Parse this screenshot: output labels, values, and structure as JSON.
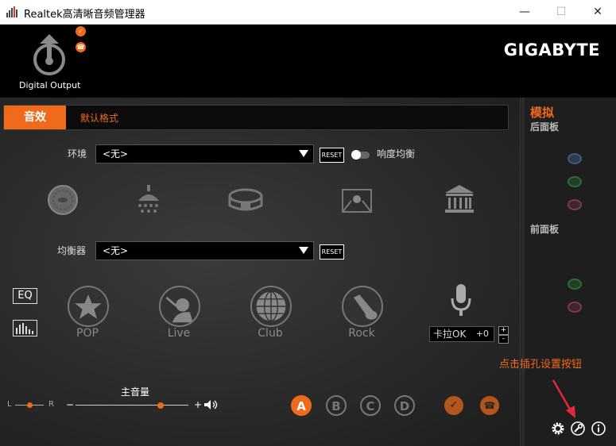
{
  "window": {
    "title": "Realtek高清晰音频管理器",
    "minimize_glyph": "—",
    "maximize_glyph": "☐",
    "close_glyph": "✕"
  },
  "header": {
    "device_label": "Digital Output",
    "brand": "GIGABYTE",
    "device_icon": "digital-output-icon"
  },
  "tabs": {
    "active": "音效",
    "default_format": "默认格式"
  },
  "environment": {
    "label": "环境",
    "value": "<无>",
    "reset": "RESET",
    "loudness_label": "响度均衡",
    "loudness_on": false,
    "icons": [
      "sewer-icon",
      "shower-icon",
      "stadium-icon",
      "room-icon",
      "concert-hall-icon"
    ]
  },
  "equalizer": {
    "label": "均衡器",
    "value": "<无>",
    "reset": "RESET",
    "eq_button": "EQ",
    "graphic_icon": "graphic-eq-icon",
    "presets": [
      "POP",
      "Live",
      "Club",
      "Rock"
    ],
    "karaoke_label": "卡拉OK",
    "karaoke_value": "+0",
    "plus": "+",
    "minus": "-"
  },
  "volume": {
    "balance_left": "L",
    "balance_right": "R",
    "master_label": "主音量",
    "minus": "−",
    "plus": "+",
    "balance_position": 0.5,
    "master_position": 0.75
  },
  "profiles": [
    "A",
    "B",
    "C",
    "D"
  ],
  "side": {
    "title": "模拟",
    "rear_panel": "后面板",
    "front_panel": "前面板"
  },
  "callout": "点击插孔设置按钮",
  "colors": {
    "accent": "#f06a1c",
    "jack_blue": "#3a5a7a",
    "jack_green": "#2f6a34",
    "jack_pink": "#7a3a4a"
  }
}
